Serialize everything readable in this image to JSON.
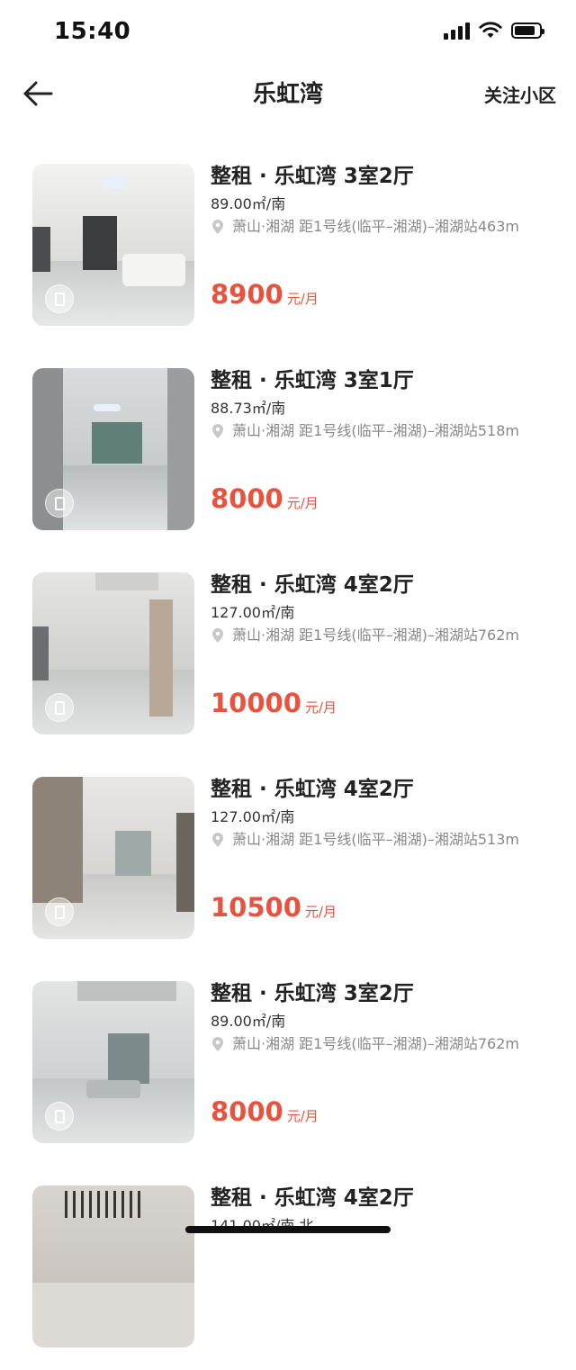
{
  "status": {
    "time": "15:40"
  },
  "nav": {
    "title": "乐虹湾",
    "follow_label": "关注小区"
  },
  "colors": {
    "price": "#e8533f",
    "text": "#222222",
    "muted": "#888888"
  },
  "listings": [
    {
      "title": "整租 · 乐虹湾 3室2厅",
      "area": "89.00㎡/南",
      "location": "萧山·湘湖 距1号线(临平–湘湖)–湘湖站463m",
      "price": "8900",
      "unit": "元/月"
    },
    {
      "title": "整租 · 乐虹湾 3室1厅",
      "area": "88.73㎡/南",
      "location": "萧山·湘湖 距1号线(临平–湘湖)–湘湖站518m",
      "price": "8000",
      "unit": "元/月"
    },
    {
      "title": "整租 · 乐虹湾 4室2厅",
      "area": "127.00㎡/南",
      "location": "萧山·湘湖 距1号线(临平–湘湖)–湘湖站762m",
      "price": "10000",
      "unit": "元/月"
    },
    {
      "title": "整租 · 乐虹湾 4室2厅",
      "area": "127.00㎡/南",
      "location": "萧山·湘湖 距1号线(临平–湘湖)–湘湖站513m",
      "price": "10500",
      "unit": "元/月"
    },
    {
      "title": "整租 · 乐虹湾 3室2厅",
      "area": "89.00㎡/南",
      "location": "萧山·湘湖 距1号线(临平–湘湖)–湘湖站762m",
      "price": "8000",
      "unit": "元/月"
    },
    {
      "title": "整租 · 乐虹湾 4室2厅",
      "area": "141.00㎡/南 北",
      "location": "",
      "price": "",
      "unit": ""
    }
  ]
}
